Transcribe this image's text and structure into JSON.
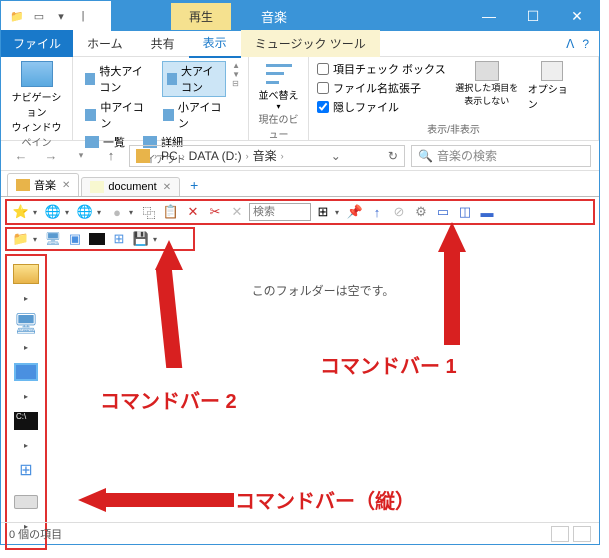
{
  "titlebar": {
    "context_tab": "再生",
    "title": "音楽"
  },
  "menubar": {
    "file": "ファイル",
    "tabs": [
      "ホーム",
      "共有",
      "表示",
      "ミュージック ツール"
    ],
    "active_index": 2
  },
  "ribbon": {
    "pane": {
      "nav_label": "ナビゲーション\nウィンドウ",
      "group": "ペイン"
    },
    "layout": {
      "opts": [
        "特大アイコン",
        "大アイコン",
        "中アイコン",
        "小アイコン",
        "一覧",
        "詳細"
      ],
      "selected": "大アイコン",
      "group": "レイアウト"
    },
    "sort": {
      "label": "並べ替え",
      "group": "現在のビュー"
    },
    "show": {
      "chk1": "項目チェック ボックス",
      "chk2": "ファイル名拡張子",
      "chk3": "隠しファイル",
      "hide_btn": "選択した項目を\n表示しない",
      "opt_btn": "オプション",
      "group": "表示/非表示"
    }
  },
  "address": {
    "segments": [
      "PC",
      "DATA (D:)",
      "音楽"
    ],
    "search_placeholder": "音楽の検索"
  },
  "tabs": [
    {
      "label": "音楽",
      "active": true
    },
    {
      "label": "document",
      "active": false
    }
  ],
  "cmdbar1": {
    "search_placeholder": "検索"
  },
  "content": {
    "empty_msg": "このフォルダーは空です。"
  },
  "statusbar": {
    "items": "0 個の項目"
  },
  "annotations": {
    "bar1": "コマンドバー 1",
    "bar2": "コマンドバー 2",
    "barv": "コマンドバー（縦）"
  }
}
